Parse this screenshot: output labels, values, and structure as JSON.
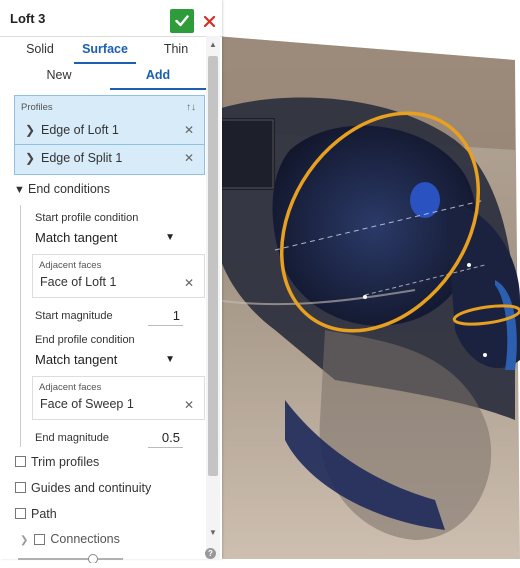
{
  "feature": {
    "title": "Loft 3",
    "confirm_icon": "checkmark-icon",
    "cancel_icon": "close-icon",
    "confirm_color": "#2e9c3a",
    "cancel_color": "#d0302a"
  },
  "creation_type": {
    "options": [
      "Solid",
      "Surface",
      "Thin"
    ],
    "selected": "Surface"
  },
  "operation": {
    "options": [
      "New",
      "Add"
    ],
    "selected": "Add"
  },
  "profiles": {
    "label": "Profiles",
    "items": [
      "Edge of Loft 1",
      "Edge of Split 1"
    ]
  },
  "end_conditions": {
    "label": "End conditions",
    "start_condition_label": "Start profile condition",
    "start_condition_value": "Match tangent",
    "start_adjacent_label": "Adjacent faces",
    "start_adjacent_value": "Face of Loft 1",
    "start_magnitude_label": "Start magnitude",
    "start_magnitude_value": "1",
    "end_condition_label": "End profile condition",
    "end_condition_value": "Match tangent",
    "end_adjacent_label": "Adjacent faces",
    "end_adjacent_value": "Face of Sweep 1",
    "end_magnitude_label": "End magnitude",
    "end_magnitude_value": "0.5"
  },
  "options": {
    "trim_profiles": "Trim profiles",
    "guides_continuity": "Guides and continuity",
    "path": "Path",
    "connections": "Connections"
  },
  "colors": {
    "accent": "#1a5fb4",
    "selection_bg": "#d8ebf8",
    "profile_highlight": "#e8a020"
  }
}
